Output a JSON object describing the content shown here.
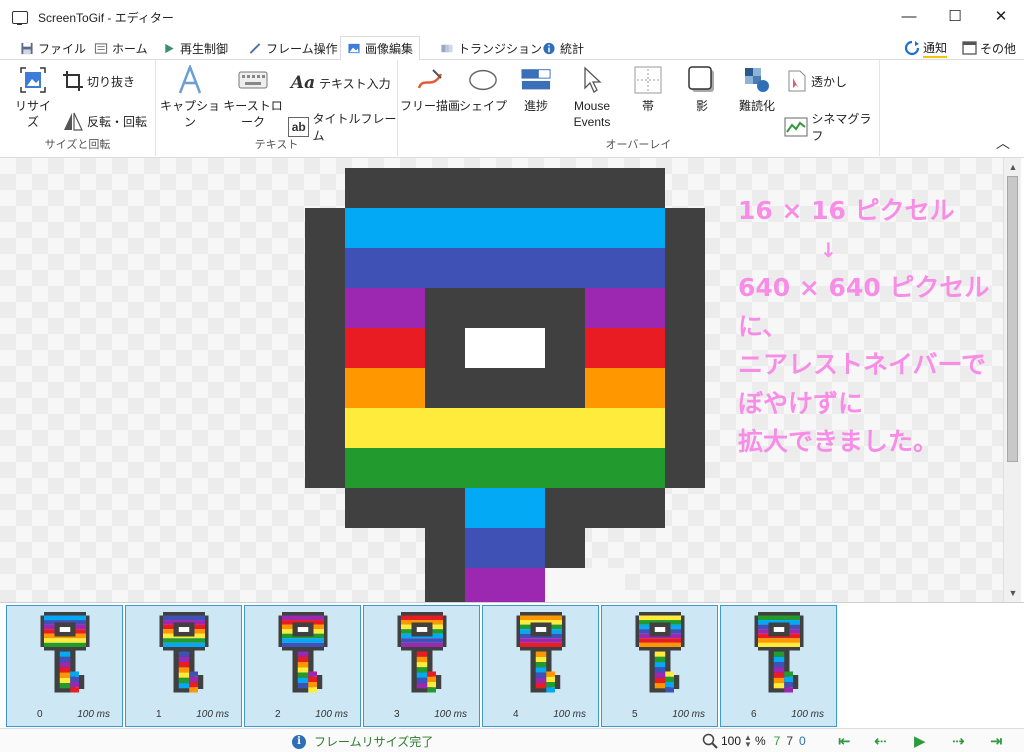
{
  "window": {
    "title": "ScreenToGif - エディター",
    "minimize": "—",
    "maximize": "☐",
    "close": "✕"
  },
  "tabs": [
    {
      "label": "ファイル",
      "icon": "save-icon"
    },
    {
      "label": "ホーム",
      "icon": "home-icon"
    },
    {
      "label": "再生制御",
      "icon": "play-icon"
    },
    {
      "label": "フレーム操作",
      "icon": "pencil-icon"
    },
    {
      "label": "画像編集",
      "icon": "image-icon",
      "active": true
    },
    {
      "label": "トランジション",
      "icon": "transition-icon"
    },
    {
      "label": "統計",
      "icon": "info-icon"
    }
  ],
  "tabs_right": {
    "notify": "通知",
    "other": "その他"
  },
  "ribbon": {
    "size_group": {
      "label": "サイズと回転",
      "resize": "リサイズ",
      "crop": "切り抜き",
      "flip": "反転・回転"
    },
    "text_group": {
      "label": "テキスト",
      "caption": "キャプション",
      "keystroke": "キーストローク",
      "freetext": "テキスト入力",
      "titleframe": "タイトルフレーム"
    },
    "overlay_group": {
      "label": "オーバーレイ",
      "freedraw": "フリー描画",
      "shape": "シェイプ",
      "progress": "進捗",
      "mouse_events_1": "Mouse",
      "mouse_events_2": "Events",
      "border": "帯",
      "shadow": "影",
      "obfuscate": "難読化",
      "watermark": "透かし",
      "cinemagraph": "シネマグラフ"
    }
  },
  "canvas": {
    "caption_lines": [
      "16 × 16 ピクセル",
      "↓",
      "640 × 640 ピクセル",
      "に、",
      "ニアレストネイバーで",
      "ぼやけずに",
      "拡大できました。"
    ]
  },
  "frames": [
    {
      "index": "0",
      "duration": "100 ms"
    },
    {
      "index": "1",
      "duration": "100 ms"
    },
    {
      "index": "2",
      "duration": "100 ms"
    },
    {
      "index": "3",
      "duration": "100 ms"
    },
    {
      "index": "4",
      "duration": "100 ms"
    },
    {
      "index": "5",
      "duration": "100 ms"
    },
    {
      "index": "6",
      "duration": "100 ms"
    }
  ],
  "statusbar": {
    "message": "フレームリサイズ完了",
    "zoom_value": "100",
    "zoom_unit": "%",
    "selected": "7",
    "total": "7",
    "current": "0"
  },
  "colors": {
    "dark": "#404040",
    "cyan": "#03a9f4",
    "indigo": "#3f51b5",
    "purple": "#9c27b0",
    "red": "#e91c23",
    "orange": "#ff9800",
    "yellow": "#ffeb3b",
    "green": "#239a2d",
    "caption": "#f78de6",
    "accent": "#3d9ad1",
    "status_green": "#2a7a2a"
  }
}
